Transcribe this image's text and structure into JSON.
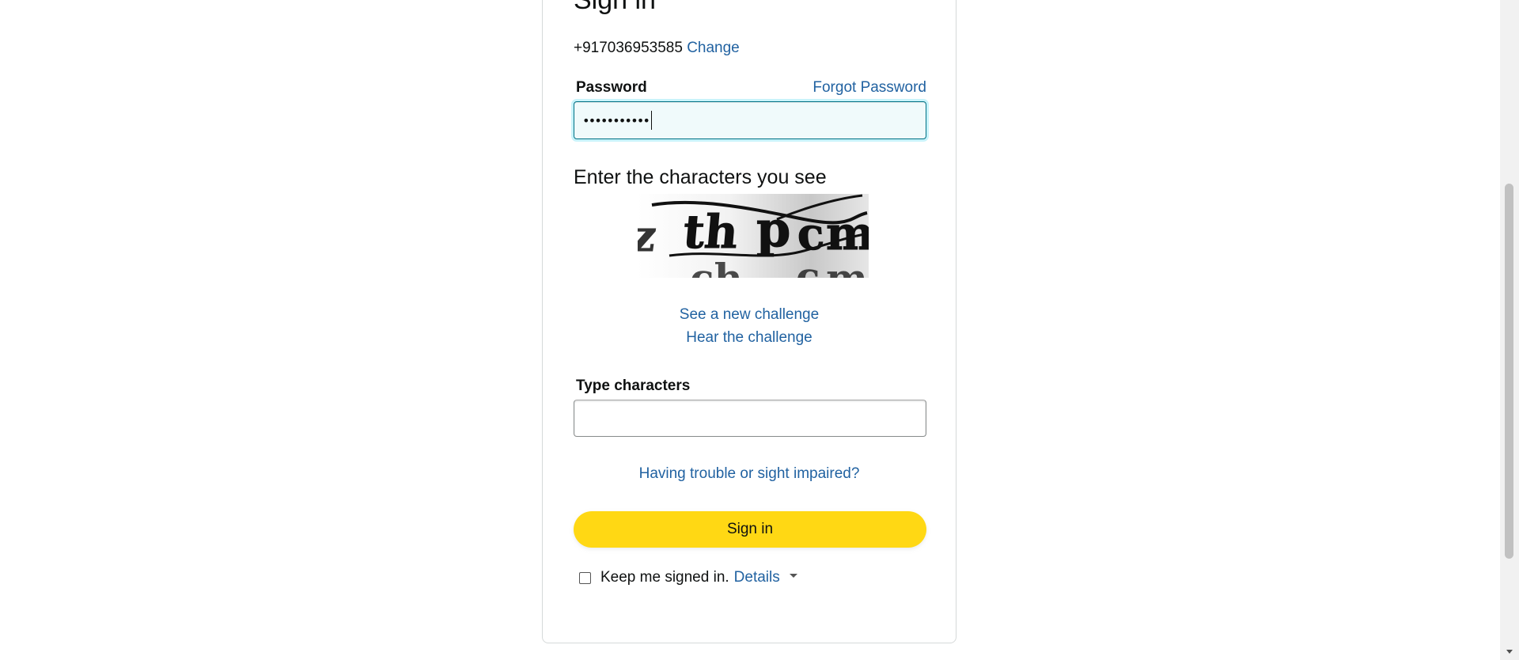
{
  "signin": {
    "title": "Sign in",
    "account": {
      "phone": "+917036953585",
      "change_link": "Change"
    },
    "password": {
      "label": "Password",
      "forgot_link": "Forgot Password",
      "masked_value": "•••••••••••"
    },
    "captcha": {
      "heading": "Enter the characters you see",
      "image_text": "zthpcm",
      "new_challenge_link": "See a new challenge",
      "hear_challenge_link": "Hear the challenge",
      "input_label": "Type characters",
      "input_value": "",
      "trouble_link": "Having trouble or sight impaired?"
    },
    "submit_label": "Sign in",
    "keep_signed_in": {
      "label": "Keep me signed in.",
      "checked": false,
      "details_link": "Details"
    }
  },
  "colors": {
    "link": "#2162a1",
    "button": "#ffd814",
    "focus_border": "#007185",
    "focus_glow": "#c8f3fa"
  },
  "icons": [
    "caret-down-icon",
    "checkbox-icon",
    "scroll-down-arrow-icon"
  ]
}
